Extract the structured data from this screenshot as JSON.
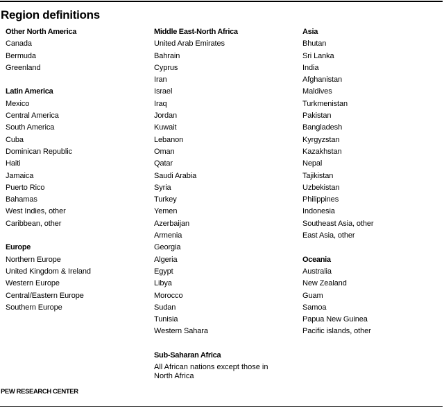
{
  "title": "Region definitions",
  "columns": [
    {
      "groups": [
        {
          "title": "Other North America",
          "items": [
            "Canada",
            "Bermuda",
            "Greenland"
          ]
        },
        {
          "title": "Latin America",
          "items": [
            "Mexico",
            "Central America",
            "South America",
            "Cuba",
            "Dominican Republic",
            "Haiti",
            "Jamaica",
            "Puerto Rico",
            "Bahamas",
            "West Indies, other",
            "Caribbean, other"
          ]
        },
        {
          "title": "Europe",
          "items": [
            "Northern Europe",
            "United Kingdom & Ireland",
            "Western Europe",
            "Central/Eastern Europe",
            "Southern Europe"
          ]
        }
      ]
    },
    {
      "groups": [
        {
          "title": "Middle East-North Africa",
          "items": [
            "United Arab Emirates",
            "Bahrain",
            "Cyprus",
            "Iran",
            "Israel",
            "Iraq",
            "Jordan",
            "Kuwait",
            "Lebanon",
            "Oman",
            "Qatar",
            "Saudi Arabia",
            "Syria",
            "Turkey",
            "Yemen",
            "Azerbaijan",
            "Armenia",
            "Georgia",
            "Algeria",
            "Egypt",
            "Libya",
            "Morocco",
            "Sudan",
            "Tunisia",
            "Western Sahara"
          ]
        },
        {
          "title": "Sub-Saharan Africa",
          "note": "All African nations except those in North Africa"
        }
      ]
    },
    {
      "groups": [
        {
          "title": "Asia",
          "items": [
            "Bhutan",
            "Sri Lanka",
            "India",
            "Afghanistan",
            "Maldives",
            "Turkmenistan",
            "Pakistan",
            "Bangladesh",
            "Kyrgyzstan",
            "Kazakhstan",
            "Nepal",
            "Tajikistan",
            "Uzbekistan",
            "Philippines",
            "Indonesia",
            "Southeast Asia, other",
            "East Asia, other"
          ]
        },
        {
          "title": "Oceania",
          "items": [
            "Australia",
            "New Zealand",
            "Guam",
            "Samoa",
            "Papua New Guinea",
            "Pacific islands, other"
          ]
        }
      ]
    }
  ],
  "footer": "PEW RESEARCH CENTER"
}
